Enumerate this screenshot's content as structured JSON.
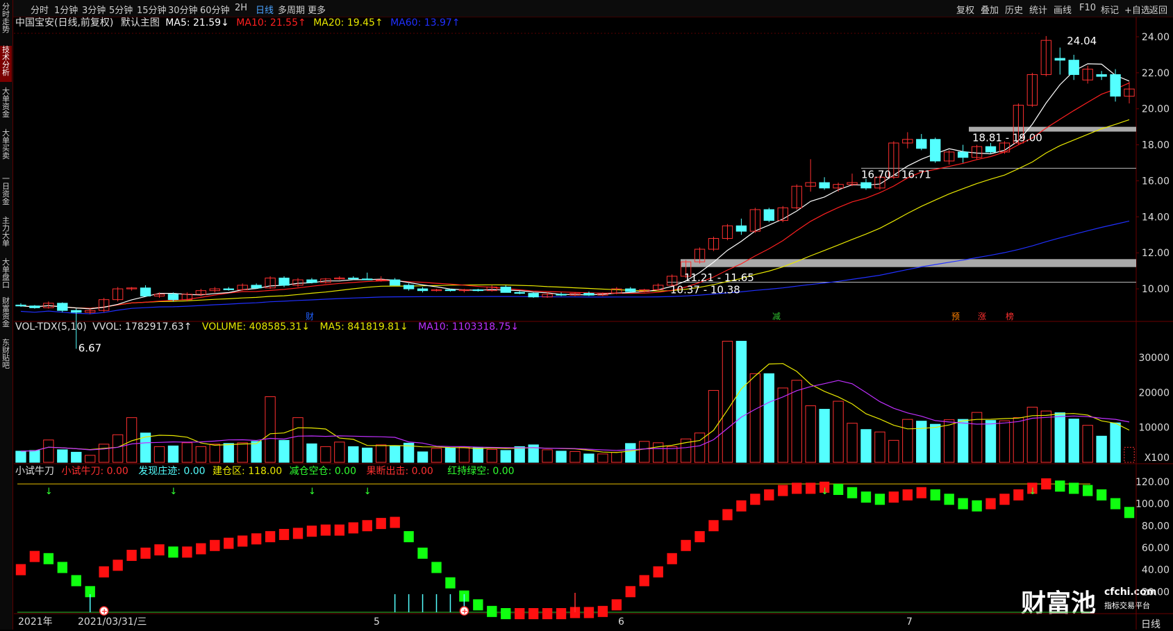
{
  "toolbar": {
    "side_tab_0": "分时走势",
    "left_items": [
      "分时",
      "1分钟",
      "3分钟",
      "5分钟",
      "15分钟",
      "30分钟",
      "60分钟",
      "2H",
      "日线",
      "多周期",
      "更多"
    ],
    "active_item": "日线",
    "right_items": [
      "复权",
      "叠加",
      "历史",
      "统计",
      "画线",
      "F10",
      "标记",
      "+自选",
      "返回"
    ]
  },
  "sidebar": {
    "tabs": [
      "技术分析",
      "大单资金",
      "大单买卖",
      "一日资金",
      "主力大单",
      "大单盘口",
      "财富资金",
      "东财贴吧"
    ],
    "active": "技术分析"
  },
  "main_legend": {
    "title": "中国宝安(日线,前复权)",
    "chart_name": "默认主图",
    "ma5": "MA5: 21.59↓",
    "ma10": "MA10: 21.55↑",
    "ma20": "MA20: 19.45↑",
    "ma60": "MA60: 13.97↑"
  },
  "vol_legend": {
    "name": "VOL-TDX(5,10)",
    "vvol": "VVOL: 1782917.63↑",
    "volume": "VOLUME: 408585.31↓",
    "ma5": "MA5: 841819.81↓",
    "ma10": "MA10: 1103318.75↓"
  },
  "ind_legend": {
    "name": "小试牛刀",
    "a": "小试牛刀: 0.00",
    "b": "发现庄迹: 0.00",
    "c": "建仓区: 118.00",
    "d": "减仓空仓: 0.00",
    "e": "果断出击: 0.00",
    "f": "红持绿空: 0.00"
  },
  "price_axis": [
    "24.00",
    "22.00",
    "20.00",
    "18.00",
    "16.00",
    "14.00",
    "12.00",
    "10.00"
  ],
  "vol_axis": [
    "30000",
    "20000",
    "10000",
    "X100"
  ],
  "ind_axis": [
    "120.00",
    "100.00",
    "80.00",
    "60.00",
    "40.00",
    "20.00"
  ],
  "annotations": {
    "high": "24.04",
    "low": "6.67",
    "zone1": "18.81 - 19.00",
    "zone2": "16.70 - 16.71",
    "zone3": "11.21 - 11.65",
    "zone4": "10.37 - 10.38"
  },
  "event_tags": [
    "财",
    "减",
    "预",
    "涨",
    "榜"
  ],
  "x_axis": [
    "2021年",
    "2021/03/31/三",
    "5",
    "6",
    "7"
  ],
  "watermark": {
    "brand": "财富池",
    "site": "cfchi.com",
    "sub": "指标交易平台",
    "period": "日线"
  },
  "colors": {
    "up": "#ff3030",
    "down": "#54ffff",
    "ma5": "#ffffff",
    "ma10": "#ff2020",
    "ma20": "#e8e800",
    "ma60": "#2030ff",
    "vol_ma10": "#c030ff"
  },
  "chart_data": [
    {
      "type": "candlestick",
      "title": "中国宝安(日线,前复权)",
      "ylim": [
        8.5,
        24.5
      ],
      "candles": [
        [
          9.1,
          9.2,
          9.0,
          9.05
        ],
        [
          9.05,
          9.1,
          8.9,
          8.95
        ],
        [
          8.95,
          9.3,
          8.9,
          9.2
        ],
        [
          9.2,
          9.25,
          8.7,
          8.8
        ],
        [
          8.8,
          8.9,
          6.67,
          8.7
        ],
        [
          8.7,
          8.9,
          8.6,
          8.8
        ],
        [
          8.8,
          9.5,
          8.7,
          9.4
        ],
        [
          9.4,
          10.1,
          9.3,
          10.0
        ],
        [
          10.0,
          10.1,
          9.9,
          10.05
        ],
        [
          10.05,
          10.2,
          9.6,
          9.6
        ],
        [
          9.6,
          9.8,
          9.5,
          9.7
        ],
        [
          9.7,
          9.8,
          9.3,
          9.4
        ],
        [
          9.4,
          9.8,
          9.3,
          9.7
        ],
        [
          9.7,
          10.0,
          9.6,
          9.9
        ],
        [
          9.9,
          10.1,
          9.8,
          10.0
        ],
        [
          10.0,
          10.1,
          9.9,
          9.95
        ],
        [
          9.95,
          10.3,
          9.9,
          10.2
        ],
        [
          10.2,
          10.3,
          10.0,
          10.05
        ],
        [
          10.05,
          10.7,
          10.0,
          10.6
        ],
        [
          10.6,
          10.7,
          10.1,
          10.2
        ],
        [
          10.2,
          10.6,
          10.1,
          10.5
        ],
        [
          10.5,
          10.6,
          10.3,
          10.35
        ],
        [
          10.35,
          10.6,
          10.3,
          10.55
        ],
        [
          10.55,
          10.7,
          10.5,
          10.6
        ],
        [
          10.6,
          10.7,
          10.5,
          10.55
        ],
        [
          10.55,
          10.9,
          10.5,
          10.5
        ],
        [
          10.5,
          10.7,
          10.4,
          10.5
        ],
        [
          10.5,
          10.6,
          10.2,
          10.2
        ],
        [
          10.2,
          10.3,
          9.9,
          10.0
        ],
        [
          10.0,
          10.1,
          9.8,
          9.9
        ],
        [
          9.9,
          10.0,
          9.85,
          9.95
        ],
        [
          9.95,
          10.0,
          9.85,
          9.9
        ],
        [
          9.9,
          10.0,
          9.8,
          9.95
        ],
        [
          9.95,
          10.0,
          9.85,
          9.9
        ],
        [
          9.9,
          10.2,
          9.85,
          10.1
        ],
        [
          10.1,
          10.2,
          9.8,
          9.8
        ],
        [
          9.8,
          9.9,
          9.7,
          9.75
        ],
        [
          9.75,
          9.8,
          9.5,
          9.55
        ],
        [
          9.55,
          9.8,
          9.5,
          9.7
        ],
        [
          9.7,
          9.8,
          9.6,
          9.65
        ],
        [
          9.65,
          9.8,
          9.6,
          9.75
        ],
        [
          9.75,
          9.85,
          9.6,
          9.65
        ],
        [
          9.65,
          9.8,
          9.6,
          9.75
        ],
        [
          9.75,
          10.1,
          9.7,
          10.0
        ],
        [
          10.0,
          10.1,
          9.8,
          9.85
        ],
        [
          9.85,
          10.0,
          9.8,
          9.95
        ],
        [
          9.95,
          10.3,
          9.9,
          10.2
        ],
        [
          10.2,
          10.8,
          10.1,
          10.7
        ],
        [
          10.7,
          11.6,
          10.6,
          11.5
        ],
        [
          11.5,
          12.3,
          11.4,
          12.2
        ],
        [
          12.2,
          12.9,
          12.1,
          12.8
        ],
        [
          12.8,
          13.6,
          12.7,
          13.5
        ],
        [
          13.5,
          13.9,
          13.0,
          13.2
        ],
        [
          13.2,
          14.5,
          13.1,
          14.4
        ],
        [
          14.4,
          14.5,
          13.7,
          13.8
        ],
        [
          13.8,
          14.6,
          13.7,
          14.5
        ],
        [
          14.5,
          15.8,
          14.4,
          15.7
        ],
        [
          15.7,
          17.2,
          15.4,
          15.9
        ],
        [
          15.9,
          16.2,
          15.5,
          15.6
        ],
        [
          15.6,
          15.9,
          15.4,
          15.8
        ],
        [
          15.8,
          16.4,
          15.7,
          15.9
        ],
        [
          15.9,
          16.1,
          15.5,
          15.6
        ],
        [
          15.6,
          16.3,
          15.5,
          16.2
        ],
        [
          16.2,
          18.2,
          16.1,
          18.1
        ],
        [
          18.1,
          18.7,
          17.8,
          18.3
        ],
        [
          18.3,
          18.6,
          17.7,
          17.8
        ],
        [
          18.3,
          18.4,
          17.0,
          17.1
        ],
        [
          17.1,
          17.7,
          16.9,
          17.6
        ],
        [
          17.6,
          18.0,
          17.0,
          17.3
        ],
        [
          17.3,
          18.0,
          17.2,
          17.9
        ],
        [
          17.9,
          18.1,
          17.5,
          17.6
        ],
        [
          17.6,
          18.2,
          17.5,
          18.1
        ],
        [
          18.1,
          20.3,
          18.0,
          20.2
        ],
        [
          20.2,
          22.0,
          20.1,
          21.9
        ],
        [
          21.9,
          24.04,
          21.8,
          23.8
        ],
        [
          22.8,
          23.4,
          21.9,
          22.7
        ],
        [
          22.7,
          23.0,
          21.6,
          21.9
        ],
        [
          21.6,
          22.4,
          21.4,
          22.2
        ],
        [
          21.9,
          22.1,
          21.6,
          21.8
        ],
        [
          21.9,
          22.2,
          20.4,
          20.7
        ],
        [
          20.7,
          21.5,
          20.3,
          21.1
        ]
      ]
    },
    {
      "type": "bar",
      "title": "VOL-TDX(5,10)",
      "ylim": [
        0,
        36000
      ],
      "values": [
        3200,
        3400,
        6400,
        3600,
        2900,
        2000,
        5200,
        7900,
        12800,
        8400,
        4500,
        4700,
        5600,
        4500,
        5200,
        5400,
        5600,
        6000,
        18800,
        6300,
        12800,
        5300,
        4500,
        5800,
        4500,
        4100,
        5000,
        4600,
        5500,
        3000,
        4000,
        4100,
        4400,
        4300,
        3700,
        3400,
        4500,
        5000,
        3600,
        3200,
        3100,
        2400,
        2400,
        2900,
        5400,
        6000,
        5600,
        4500,
        6700,
        8400,
        20600,
        34700,
        34700,
        25400,
        25400,
        21300,
        23500,
        16200,
        15200,
        17500,
        11200,
        9400,
        8700,
        6300,
        12300,
        11800,
        10900,
        12200,
        12300,
        14300,
        12000,
        11900,
        12800,
        15800,
        14700,
        14200,
        12400,
        10600,
        7500,
        11300,
        4300
      ]
    },
    {
      "type": "bar",
      "title": "小试牛刀",
      "ylim": [
        0,
        125
      ],
      "values": [
        40,
        52,
        50,
        42,
        30,
        20,
        38,
        44,
        53,
        55,
        58,
        56,
        56,
        59,
        62,
        64,
        66,
        68,
        70,
        72,
        73,
        75,
        76,
        76,
        78,
        80,
        82,
        83,
        70,
        55,
        42,
        28,
        16,
        8,
        2,
        0,
        0,
        0,
        0,
        0,
        1,
        1,
        2,
        8,
        20,
        30,
        38,
        50,
        62,
        70,
        80,
        90,
        98,
        104,
        108,
        112,
        114,
        114,
        115,
        113,
        110,
        106,
        104,
        106,
        108,
        110,
        108,
        104,
        100,
        98,
        100,
        104,
        108,
        114,
        118,
        116,
        114,
        112,
        108,
        100,
        92
      ]
    }
  ]
}
